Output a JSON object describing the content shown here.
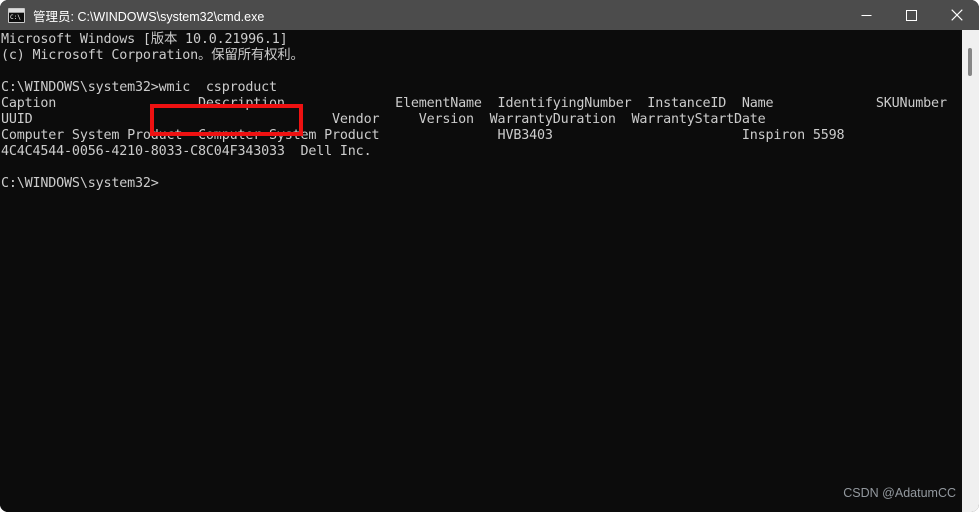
{
  "window": {
    "title": "管理员: C:\\WINDOWS\\system32\\cmd.exe",
    "icon": "cmd-console-icon",
    "icon_text": "C:\\",
    "background_color": "#0c0c0c",
    "titlebar_color": "#4c4c4c",
    "controls": {
      "minimize_label": "—",
      "maximize_label": "□",
      "close_label": "✕"
    }
  },
  "console": {
    "text": "Microsoft Windows [版本 10.0.21996.1]\n(c) Microsoft Corporation。保留所有权利。\n\nC:\\WINDOWS\\system32>wmic  csproduct\nCaption                  Description              ElementName  IdentifyingNumber  InstanceID  Name             SKUNumber\nUUID                                      Vendor     Version  WarrantyDuration  WarrantyStartDate\nComputer System Product  Computer System Product               HVB3403                        Inspiron 5598\n4C4C4544-0056-4210-8033-C8C04F343033  Dell Inc.\n\nC:\\WINDOWS\\system32>",
    "lines": [
      "Microsoft Windows [版本 10.0.21996.1]",
      "(c) Microsoft Corporation。保留所有权利。",
      "",
      "C:\\WINDOWS\\system32>wmic  csproduct",
      "Caption                  Description              ElementName  IdentifyingNumber  InstanceID  Name             SKUNumber",
      "UUID                                      Vendor     Version  WarrantyDuration  WarrantyStartDate",
      "Computer System Product  Computer System Product               HVB3403                        Inspiron 5598",
      "4C4C4544-0056-4210-8033-C8C04F343033  Dell Inc.",
      "",
      "C:\\WINDOWS\\system32>"
    ],
    "prompt": "C:\\WINDOWS\\system32>",
    "command": "wmic  csproduct",
    "banner": {
      "line1": "Microsoft Windows [版本 10.0.21996.1]",
      "line2": "(c) Microsoft Corporation。保留所有权利。"
    },
    "result": {
      "headers_row1": [
        "Caption",
        "Description",
        "ElementName",
        "IdentifyingNumber",
        "InstanceID",
        "Name",
        "SKUNumber"
      ],
      "headers_row2": [
        "UUID",
        "Vendor",
        "Version",
        "WarrantyDuration",
        "WarrantyStartDate"
      ],
      "values": {
        "Caption": "Computer System Product",
        "Description": "Computer System Product",
        "ElementName": "",
        "IdentifyingNumber": "HVB3403",
        "InstanceID": "",
        "Name": "Inspiron 5598",
        "SKUNumber": "",
        "UUID": "4C4C4544-0056-4210-8033-C8C04F343033",
        "Vendor": "Dell Inc.",
        "Version": "",
        "WarrantyDuration": "",
        "WarrantyStartDate": ""
      }
    },
    "text_color": "#cccccc"
  },
  "annotation": {
    "shape": "rectangle",
    "color": "#ee1111",
    "target_text": "wmic  csproduct"
  },
  "watermark": {
    "text": "CSDN @AdatumCC",
    "color": "#9aa0a6"
  },
  "scrollbar": {
    "orientation": "vertical",
    "track_color": "#f0f0f0",
    "thumb_color": "#868686"
  }
}
